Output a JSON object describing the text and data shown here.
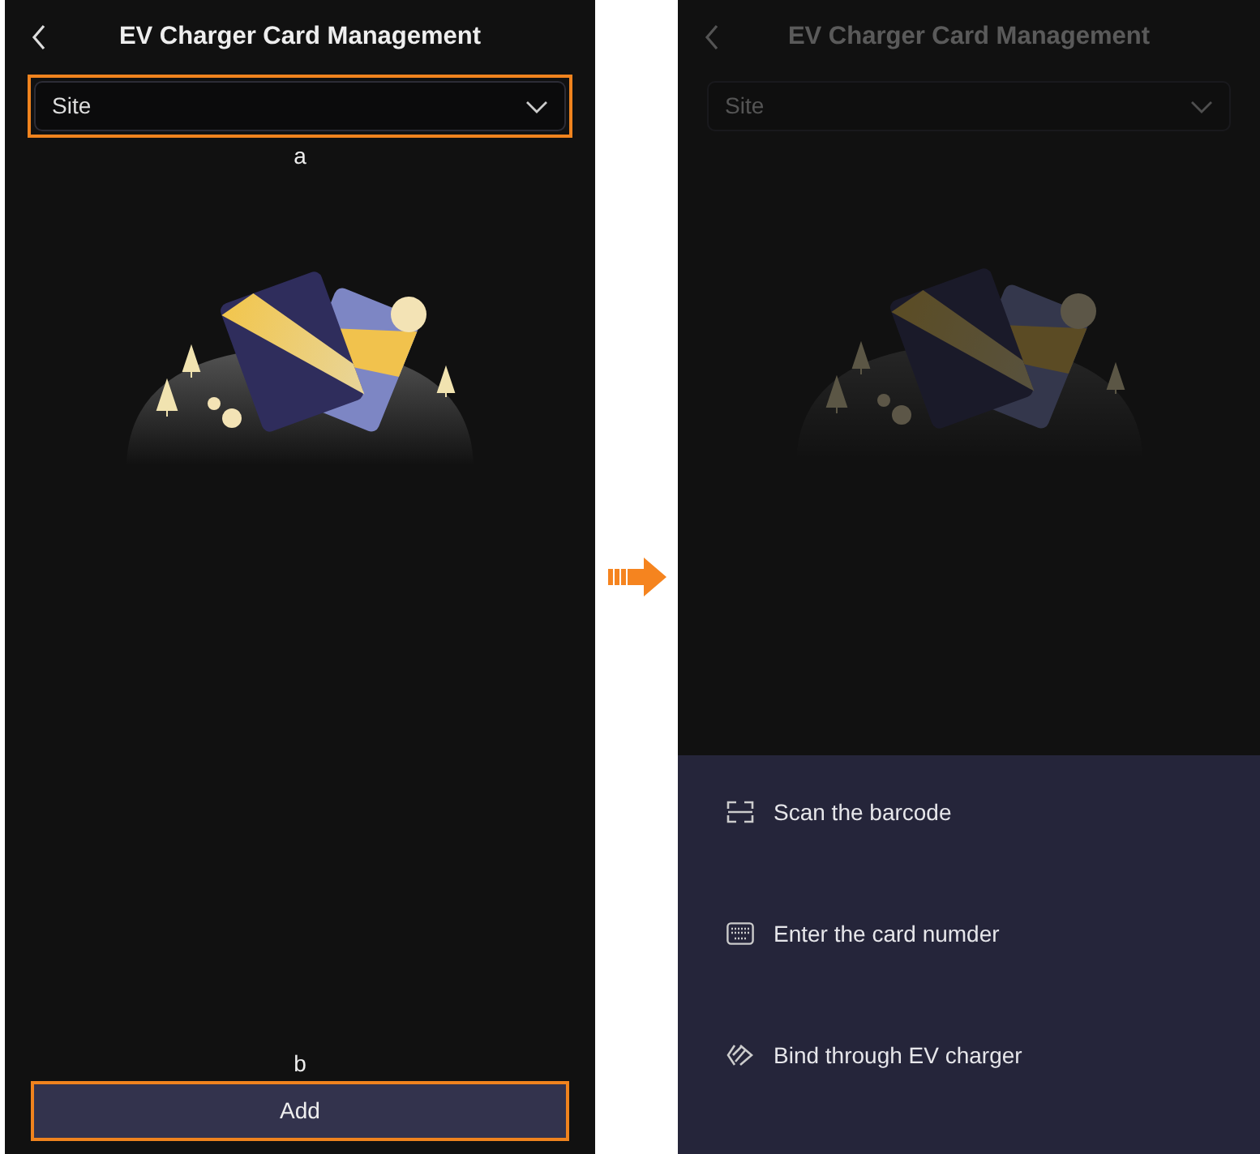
{
  "screens": [
    {
      "title": "EV Charger Card Management",
      "site_dropdown": {
        "value": "Site",
        "highlighted": true,
        "callout": "a"
      },
      "add_button": {
        "label": "Add",
        "highlighted": true,
        "callout": "b"
      },
      "dimmed": false
    },
    {
      "title": "EV Charger Card Management",
      "site_dropdown": {
        "value": "Site",
        "highlighted": false
      },
      "dimmed": true,
      "action_sheet": [
        {
          "kind": "scan",
          "label": "Scan the barcode"
        },
        {
          "kind": "keyboard",
          "label": "Enter the card numder"
        },
        {
          "kind": "bind",
          "label": "Bind through EV charger"
        }
      ]
    }
  ]
}
